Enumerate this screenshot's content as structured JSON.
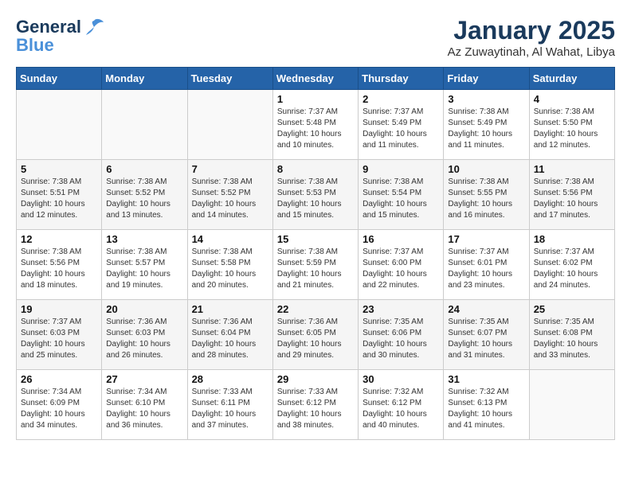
{
  "logo": {
    "line1": "General",
    "line2": "Blue"
  },
  "title": "January 2025",
  "subtitle": "Az Zuwaytinah, Al Wahat, Libya",
  "weekdays": [
    "Sunday",
    "Monday",
    "Tuesday",
    "Wednesday",
    "Thursday",
    "Friday",
    "Saturday"
  ],
  "weeks": [
    [
      {
        "day": "",
        "sunrise": "",
        "sunset": "",
        "daylight": ""
      },
      {
        "day": "",
        "sunrise": "",
        "sunset": "",
        "daylight": ""
      },
      {
        "day": "",
        "sunrise": "",
        "sunset": "",
        "daylight": ""
      },
      {
        "day": "1",
        "sunrise": "Sunrise: 7:37 AM",
        "sunset": "Sunset: 5:48 PM",
        "daylight": "Daylight: 10 hours and 10 minutes."
      },
      {
        "day": "2",
        "sunrise": "Sunrise: 7:37 AM",
        "sunset": "Sunset: 5:49 PM",
        "daylight": "Daylight: 10 hours and 11 minutes."
      },
      {
        "day": "3",
        "sunrise": "Sunrise: 7:38 AM",
        "sunset": "Sunset: 5:49 PM",
        "daylight": "Daylight: 10 hours and 11 minutes."
      },
      {
        "day": "4",
        "sunrise": "Sunrise: 7:38 AM",
        "sunset": "Sunset: 5:50 PM",
        "daylight": "Daylight: 10 hours and 12 minutes."
      }
    ],
    [
      {
        "day": "5",
        "sunrise": "Sunrise: 7:38 AM",
        "sunset": "Sunset: 5:51 PM",
        "daylight": "Daylight: 10 hours and 12 minutes."
      },
      {
        "day": "6",
        "sunrise": "Sunrise: 7:38 AM",
        "sunset": "Sunset: 5:52 PM",
        "daylight": "Daylight: 10 hours and 13 minutes."
      },
      {
        "day": "7",
        "sunrise": "Sunrise: 7:38 AM",
        "sunset": "Sunset: 5:52 PM",
        "daylight": "Daylight: 10 hours and 14 minutes."
      },
      {
        "day": "8",
        "sunrise": "Sunrise: 7:38 AM",
        "sunset": "Sunset: 5:53 PM",
        "daylight": "Daylight: 10 hours and 15 minutes."
      },
      {
        "day": "9",
        "sunrise": "Sunrise: 7:38 AM",
        "sunset": "Sunset: 5:54 PM",
        "daylight": "Daylight: 10 hours and 15 minutes."
      },
      {
        "day": "10",
        "sunrise": "Sunrise: 7:38 AM",
        "sunset": "Sunset: 5:55 PM",
        "daylight": "Daylight: 10 hours and 16 minutes."
      },
      {
        "day": "11",
        "sunrise": "Sunrise: 7:38 AM",
        "sunset": "Sunset: 5:56 PM",
        "daylight": "Daylight: 10 hours and 17 minutes."
      }
    ],
    [
      {
        "day": "12",
        "sunrise": "Sunrise: 7:38 AM",
        "sunset": "Sunset: 5:56 PM",
        "daylight": "Daylight: 10 hours and 18 minutes."
      },
      {
        "day": "13",
        "sunrise": "Sunrise: 7:38 AM",
        "sunset": "Sunset: 5:57 PM",
        "daylight": "Daylight: 10 hours and 19 minutes."
      },
      {
        "day": "14",
        "sunrise": "Sunrise: 7:38 AM",
        "sunset": "Sunset: 5:58 PM",
        "daylight": "Daylight: 10 hours and 20 minutes."
      },
      {
        "day": "15",
        "sunrise": "Sunrise: 7:38 AM",
        "sunset": "Sunset: 5:59 PM",
        "daylight": "Daylight: 10 hours and 21 minutes."
      },
      {
        "day": "16",
        "sunrise": "Sunrise: 7:37 AM",
        "sunset": "Sunset: 6:00 PM",
        "daylight": "Daylight: 10 hours and 22 minutes."
      },
      {
        "day": "17",
        "sunrise": "Sunrise: 7:37 AM",
        "sunset": "Sunset: 6:01 PM",
        "daylight": "Daylight: 10 hours and 23 minutes."
      },
      {
        "day": "18",
        "sunrise": "Sunrise: 7:37 AM",
        "sunset": "Sunset: 6:02 PM",
        "daylight": "Daylight: 10 hours and 24 minutes."
      }
    ],
    [
      {
        "day": "19",
        "sunrise": "Sunrise: 7:37 AM",
        "sunset": "Sunset: 6:03 PM",
        "daylight": "Daylight: 10 hours and 25 minutes."
      },
      {
        "day": "20",
        "sunrise": "Sunrise: 7:36 AM",
        "sunset": "Sunset: 6:03 PM",
        "daylight": "Daylight: 10 hours and 26 minutes."
      },
      {
        "day": "21",
        "sunrise": "Sunrise: 7:36 AM",
        "sunset": "Sunset: 6:04 PM",
        "daylight": "Daylight: 10 hours and 28 minutes."
      },
      {
        "day": "22",
        "sunrise": "Sunrise: 7:36 AM",
        "sunset": "Sunset: 6:05 PM",
        "daylight": "Daylight: 10 hours and 29 minutes."
      },
      {
        "day": "23",
        "sunrise": "Sunrise: 7:35 AM",
        "sunset": "Sunset: 6:06 PM",
        "daylight": "Daylight: 10 hours and 30 minutes."
      },
      {
        "day": "24",
        "sunrise": "Sunrise: 7:35 AM",
        "sunset": "Sunset: 6:07 PM",
        "daylight": "Daylight: 10 hours and 31 minutes."
      },
      {
        "day": "25",
        "sunrise": "Sunrise: 7:35 AM",
        "sunset": "Sunset: 6:08 PM",
        "daylight": "Daylight: 10 hours and 33 minutes."
      }
    ],
    [
      {
        "day": "26",
        "sunrise": "Sunrise: 7:34 AM",
        "sunset": "Sunset: 6:09 PM",
        "daylight": "Daylight: 10 hours and 34 minutes."
      },
      {
        "day": "27",
        "sunrise": "Sunrise: 7:34 AM",
        "sunset": "Sunset: 6:10 PM",
        "daylight": "Daylight: 10 hours and 36 minutes."
      },
      {
        "day": "28",
        "sunrise": "Sunrise: 7:33 AM",
        "sunset": "Sunset: 6:11 PM",
        "daylight": "Daylight: 10 hours and 37 minutes."
      },
      {
        "day": "29",
        "sunrise": "Sunrise: 7:33 AM",
        "sunset": "Sunset: 6:12 PM",
        "daylight": "Daylight: 10 hours and 38 minutes."
      },
      {
        "day": "30",
        "sunrise": "Sunrise: 7:32 AM",
        "sunset": "Sunset: 6:12 PM",
        "daylight": "Daylight: 10 hours and 40 minutes."
      },
      {
        "day": "31",
        "sunrise": "Sunrise: 7:32 AM",
        "sunset": "Sunset: 6:13 PM",
        "daylight": "Daylight: 10 hours and 41 minutes."
      },
      {
        "day": "",
        "sunrise": "",
        "sunset": "",
        "daylight": ""
      }
    ]
  ]
}
